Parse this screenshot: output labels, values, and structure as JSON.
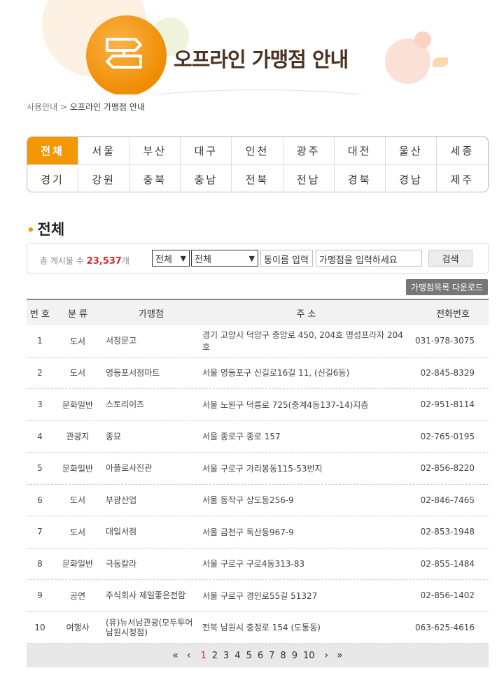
{
  "header": {
    "title": "오프라인 가맹점 안내"
  },
  "breadcrumb": {
    "parent": "사용안내",
    "current": "오프라인 가맹점 안내"
  },
  "regions": [
    "전체",
    "서울",
    "부산",
    "대구",
    "인천",
    "광주",
    "대전",
    "울산",
    "세종",
    "경기",
    "강원",
    "충북",
    "충남",
    "전북",
    "전남",
    "경북",
    "경남",
    "제주"
  ],
  "section": {
    "title": "전체"
  },
  "search": {
    "count_label": "총 게시물 수",
    "count_value": "23,537",
    "count_unit": "개",
    "select1": "전체",
    "select2": "전체",
    "district_placeholder": "동이름 입력",
    "store_placeholder": "가맹점을 입력하세요",
    "button": "검색"
  },
  "download_button": "가맹점목록 다운로드",
  "table": {
    "headers": {
      "no": "번 호",
      "category": "분 류",
      "name": "가맹점",
      "address": "주 소",
      "tel": "전화번호"
    },
    "rows": [
      {
        "no": "1",
        "category": "도서",
        "name": "서정문고",
        "address": "경기 고양시 덕양구 중앙로 450, 204호 명성프라자 204호",
        "tel": "031-978-3075"
      },
      {
        "no": "2",
        "category": "도서",
        "name": "영등포서점마트",
        "address": "서울 영등포구 신길로16길 11, (신길6동)",
        "tel": "02-845-8329"
      },
      {
        "no": "3",
        "category": "문화일반",
        "name": "스토리이즈",
        "address": "서울 노원구 덕릉로 725(중계4동137-14)지층",
        "tel": "02-951-8114"
      },
      {
        "no": "4",
        "category": "관광지",
        "name": "종묘",
        "address": "서울 종로구 종로 157",
        "tel": "02-765-0195"
      },
      {
        "no": "5",
        "category": "문화일반",
        "name": "아플로사진관",
        "address": "서울 구로구 가리봉동115-53번지",
        "tel": "02-856-8220"
      },
      {
        "no": "6",
        "category": "도서",
        "name": "부광산업",
        "address": "서울 동작구 상도동256-9",
        "tel": "02-846-7465"
      },
      {
        "no": "7",
        "category": "도서",
        "name": "대일서점",
        "address": "서울 금천구 독산동967-9",
        "tel": "02-853-1948"
      },
      {
        "no": "8",
        "category": "문화일반",
        "name": "극동칼라",
        "address": "서울 구로구 구로4동313-83",
        "tel": "02-855-1484"
      },
      {
        "no": "9",
        "category": "공연",
        "name": "주식회사 제일좋은전람",
        "address": "서울 구로구 경인로55길 51327",
        "tel": "02-856-1402"
      },
      {
        "no": "10",
        "category": "여행사",
        "name": "(유)뉴서남관광(모두투어남원시청점)",
        "address": "전북 남원시 충정로 154 (도통동)",
        "tel": "063-625-4616"
      }
    ]
  },
  "pager": {
    "first": "«",
    "prev": "‹",
    "pages": [
      "1",
      "2",
      "3",
      "4",
      "5",
      "6",
      "7",
      "8",
      "9",
      "10"
    ],
    "current": "1",
    "next": "›",
    "last": "»"
  },
  "colors": {
    "accent": "#f39800",
    "highlight": "#d62b2b",
    "heading": "#4b3222"
  }
}
